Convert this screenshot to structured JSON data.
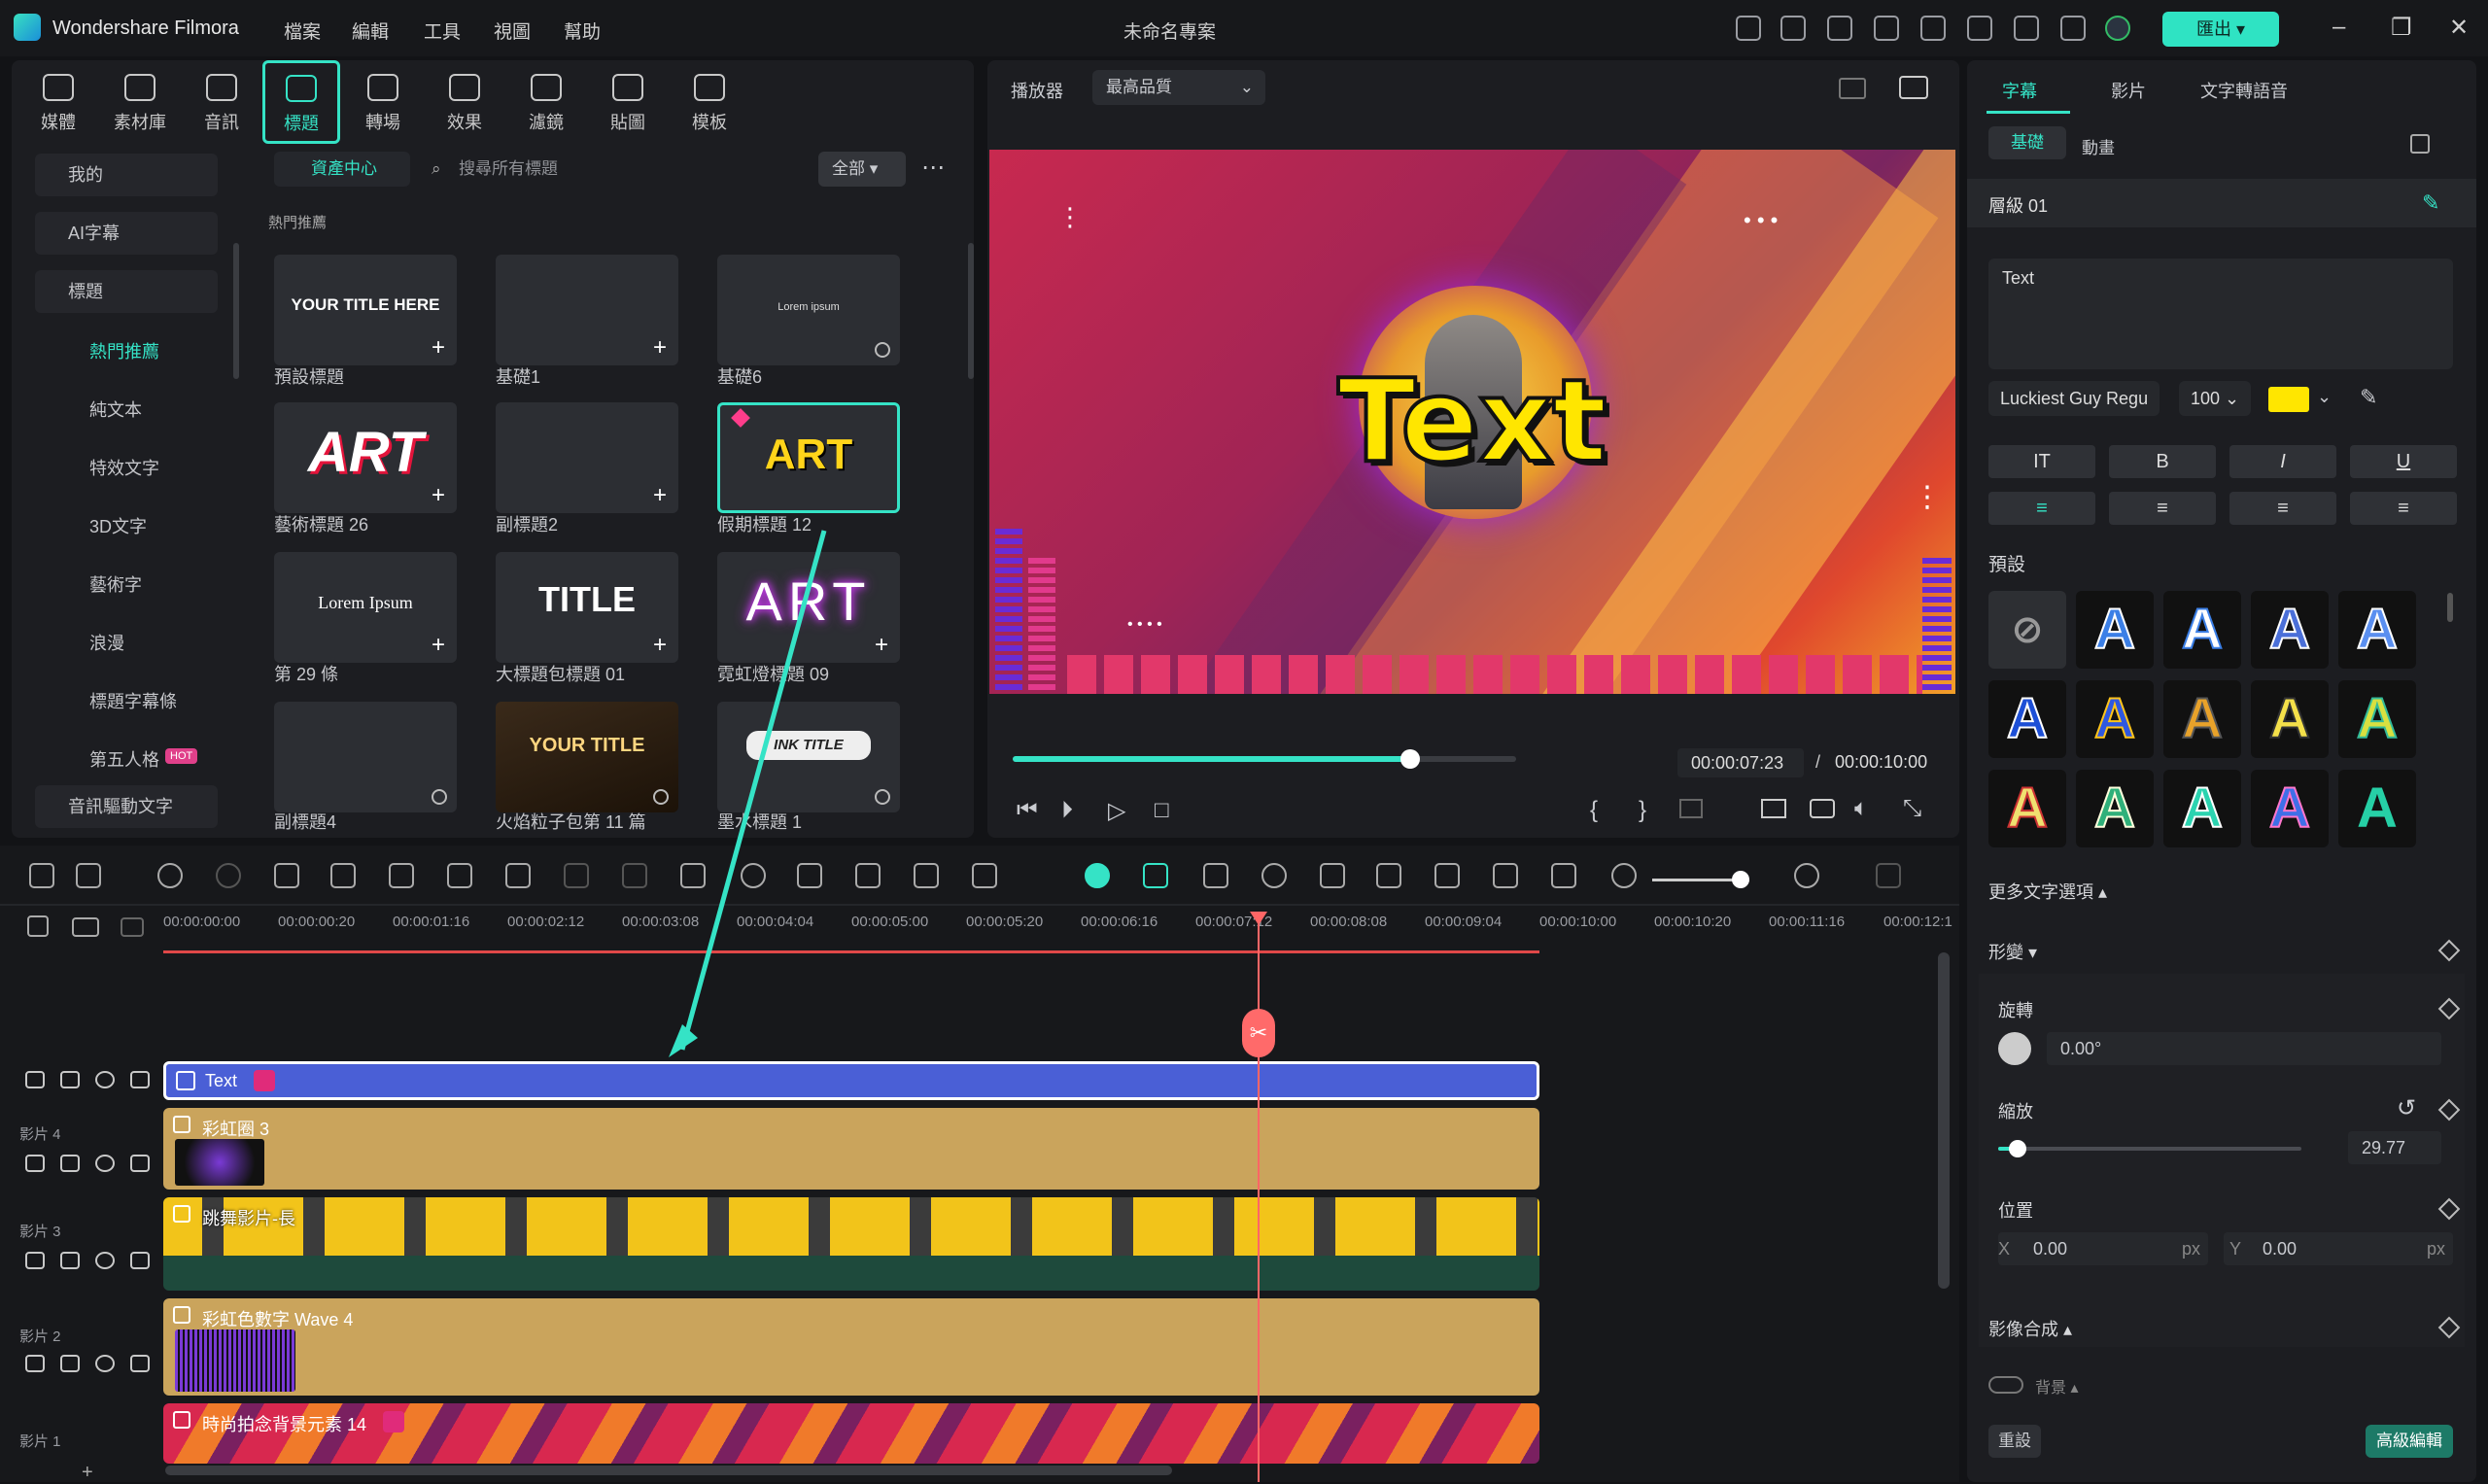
{
  "app": {
    "name": "Wondershare Filmora",
    "project_title": "未命名專案"
  },
  "menu": [
    "檔案",
    "編輯",
    "工具",
    "視圖",
    "幫助"
  ],
  "export_label": "匯出",
  "media_tabs": [
    "媒體",
    "素材庫",
    "音訊",
    "標題",
    "轉場",
    "效果",
    "濾鏡",
    "貼圖",
    "模板"
  ],
  "library": {
    "nav": [
      "我的",
      "AI字幕",
      "標題"
    ],
    "subnav": [
      "熱門推薦",
      "純文本",
      "特效文字",
      "3D文字",
      "藝術字",
      "浪漫",
      "標題字幕條",
      "第五人格",
      "音訊驅動文字"
    ],
    "hot_badge": "HOT",
    "asset_center": "資產中心",
    "search_placeholder": "搜尋所有標題",
    "filter": "全部",
    "section": "熱門推薦",
    "cards": [
      {
        "label": "預設標題",
        "thumb": "YOUR TITLE HERE"
      },
      {
        "label": "基礎1",
        "thumb": ""
      },
      {
        "label": "基礎6",
        "thumb": "Lorem ipsum"
      },
      {
        "label": "藝術標題 26",
        "thumb": "ART"
      },
      {
        "label": "副標題2",
        "thumb": ""
      },
      {
        "label": "假期標題 12",
        "thumb": "ART"
      },
      {
        "label": "第 29 條",
        "thumb": "Lorem Ipsum"
      },
      {
        "label": "大標題包標題 01",
        "thumb": "TITLE"
      },
      {
        "label": "霓虹燈標題 09",
        "thumb": "ART"
      },
      {
        "label": "副標題4",
        "thumb": ""
      },
      {
        "label": "火焰粒子包第 11 篇",
        "thumb": "YOUR TITLE"
      },
      {
        "label": "墨水標題 1",
        "thumb": "INK TITLE"
      }
    ]
  },
  "player": {
    "label": "播放器",
    "quality": "最高品質",
    "preview_text": "Text",
    "current_time": "00:00:07:23",
    "total_time": "00:00:10:00",
    "progress": 0.79
  },
  "timeline": {
    "ruler": [
      "00:00:00:00",
      "00:00:00:20",
      "00:00:01:16",
      "00:00:02:12",
      "00:00:03:08",
      "00:00:04:04",
      "00:00:05:00",
      "00:00:05:20",
      "00:00:06:16",
      "00:00:07:12",
      "00:00:08:08",
      "00:00:09:04",
      "00:00:10:00",
      "00:00:10:20",
      "00:00:11:16",
      "00:00:12:1"
    ],
    "tracks": [
      {
        "name": "",
        "clip": "Text"
      },
      {
        "name": "影片 4",
        "clip": "彩虹圈 3"
      },
      {
        "name": "影片 3",
        "clip": "跳舞影片-長"
      },
      {
        "name": "影片 2",
        "clip": "彩虹色數字 Wave 4"
      },
      {
        "name": "影片 1",
        "clip": "時尚拍念背景元素 14"
      }
    ]
  },
  "props": {
    "tabs": [
      "字幕",
      "影片",
      "文字轉語音"
    ],
    "subtabs": [
      "基礎",
      "動畫"
    ],
    "layer": "層級 01",
    "text_value": "Text",
    "font": "Luckiest Guy Regu",
    "size": "100",
    "text_color": "#ffe600",
    "format_buttons": [
      "IT",
      "B",
      "I",
      "U"
    ],
    "preset_label": "預設",
    "more_options": "更多文字選項",
    "transform": "形變",
    "rotate_label": "旋轉",
    "rotate_value": "0.00°",
    "scale_label": "縮放",
    "scale_value": "29.77",
    "position_label": "位置",
    "pos_x_label": "X",
    "pos_x": "0.00",
    "pos_y_label": "Y",
    "pos_y": "0.00",
    "unit": "px",
    "compositing": "影像合成",
    "background": "背景",
    "reset": "重設",
    "advanced": "高級編輯"
  }
}
